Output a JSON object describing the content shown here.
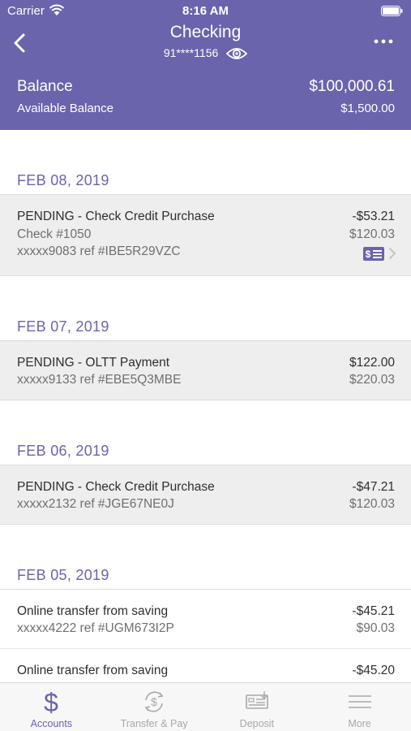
{
  "status_bar": {
    "carrier": "Carrier",
    "time": "8:16 AM"
  },
  "header": {
    "title": "Checking",
    "account_number": "91****1156",
    "balance_label": "Balance",
    "balance_value": "$100,000.61",
    "available_label": "Available Balance",
    "available_value": "$1,500.00"
  },
  "groups": [
    {
      "date": "FEB 08, 2019",
      "transactions": [
        {
          "description": "PENDING - Check Credit Purchase",
          "amount": "-$53.21",
          "detail": "Check #1050",
          "balance": "$120.03",
          "reference": "xxxxx9083 ref #IBE5R29VZC",
          "has_check_image": true
        }
      ]
    },
    {
      "date": "FEB 07, 2019",
      "transactions": [
        {
          "description": "PENDING - OLTT Payment",
          "amount": "$122.00",
          "reference": "xxxxx9133 ref #EBE5Q3MBE",
          "balance": "$220.03"
        }
      ]
    },
    {
      "date": "FEB 06, 2019",
      "transactions": [
        {
          "description": "PENDING - Check Credit Purchase",
          "amount": "-$47.21",
          "reference": "xxxxx2132 ref #JGE67NE0J",
          "balance": "$120.03"
        }
      ]
    },
    {
      "date": "FEB 05, 2019",
      "transactions": [
        {
          "description": "Online transfer from saving",
          "amount": "-$45.21",
          "reference": "xxxxx4222 ref #UGM673I2P",
          "balance": "$90.03"
        },
        {
          "description": "Online transfer from saving",
          "amount": "-$45.20",
          "reference": "",
          "balance": ""
        }
      ]
    }
  ],
  "tabbar": {
    "tabs": [
      {
        "label": "Accounts",
        "icon": "dollar-icon",
        "active": true
      },
      {
        "label": "Transfer & Pay",
        "icon": "transfer-icon",
        "active": false
      },
      {
        "label": "Deposit",
        "icon": "deposit-icon",
        "active": false
      },
      {
        "label": "More",
        "icon": "menu-icon",
        "active": false
      }
    ]
  },
  "colors": {
    "brand": "#6a64ad",
    "row_bg": "#eeeeee",
    "tab_inactive": "#a8a8a8"
  }
}
